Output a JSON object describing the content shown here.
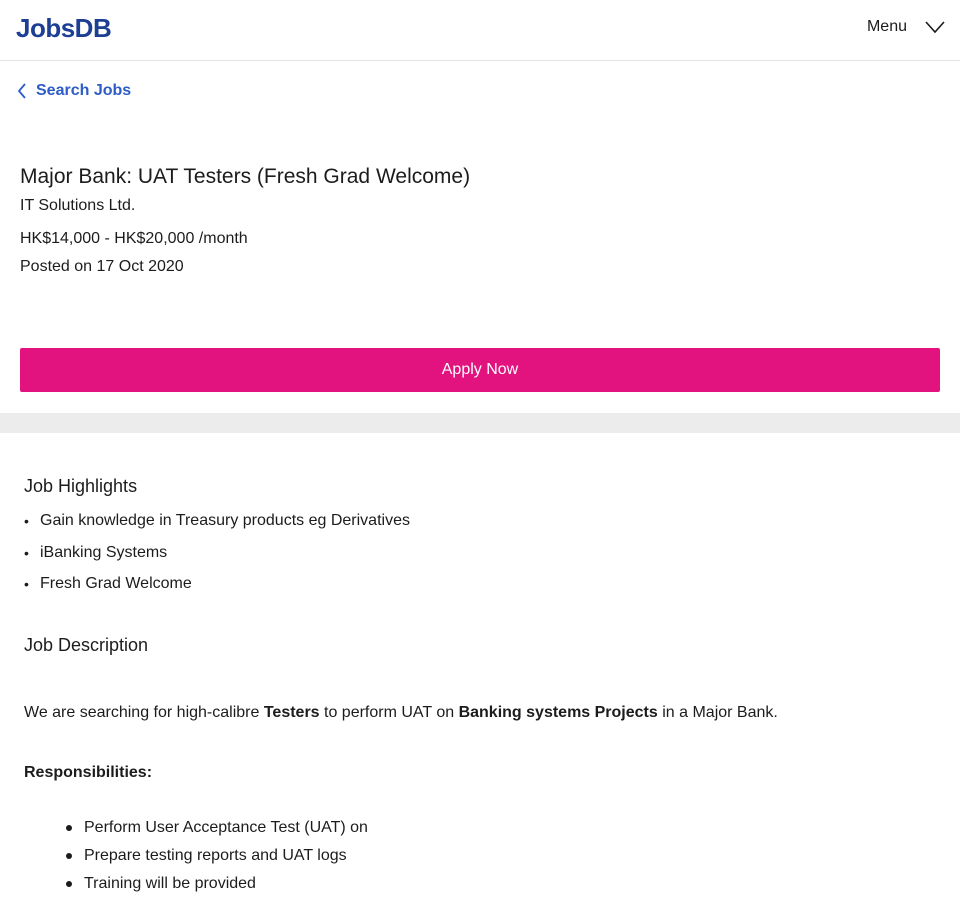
{
  "header": {
    "logo_text": "JobsDB",
    "menu_label": "Menu",
    "menu_icon": "chevron-down-icon"
  },
  "nav": {
    "back_label": "Search Jobs",
    "back_icon": "chevron-left-icon"
  },
  "job": {
    "title": "Major Bank: UAT Testers (Fresh Grad Welcome)",
    "company": "IT Solutions Ltd.",
    "salary": "HK$14,000 - HK$20,000 /month",
    "posted_prefix": "Posted on ",
    "posted_date": "17 Oct 2020",
    "apply_label": "Apply Now"
  },
  "colors": {
    "brand_blue": "#1c3f94",
    "link_blue": "#2d5cc7",
    "apply_pink": "#e2137e"
  },
  "highlights": {
    "title": "Job Highlights",
    "items": [
      "Gain knowledge in Treasury products eg Derivatives",
      "iBanking Systems",
      "Fresh Grad Welcome"
    ]
  },
  "description": {
    "title": "Job Description",
    "intro": {
      "part1": "We are searching for high-calibre ",
      "bold1": "Testers",
      "part2": " to perform UAT on ",
      "bold2": "Banking systems Projects",
      "part3": " in a Major Bank."
    },
    "responsibilities_title": "Responsibilities:",
    "responsibilities": [
      "Perform User Acceptance Test (UAT) on",
      "Prepare testing reports and UAT logs",
      "Training will be provided"
    ]
  }
}
